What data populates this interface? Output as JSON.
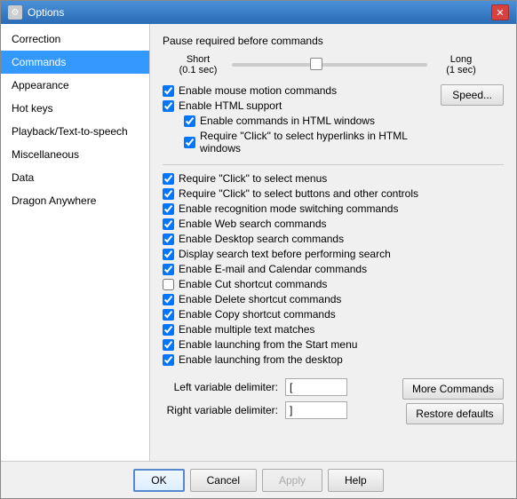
{
  "window": {
    "title": "Options",
    "close_label": "✕"
  },
  "sidebar": {
    "items": [
      {
        "id": "correction",
        "label": "Correction",
        "active": false
      },
      {
        "id": "commands",
        "label": "Commands",
        "active": true
      },
      {
        "id": "appearance",
        "label": "Appearance",
        "active": false
      },
      {
        "id": "hotkeys",
        "label": "Hot keys",
        "active": false
      },
      {
        "id": "playback",
        "label": "Playback/Text-to-speech",
        "active": false
      },
      {
        "id": "miscellaneous",
        "label": "Miscellaneous",
        "active": false
      },
      {
        "id": "data",
        "label": "Data",
        "active": false
      },
      {
        "id": "dragon-anywhere",
        "label": "Dragon Anywhere",
        "active": false
      }
    ]
  },
  "main": {
    "pause_label": "Pause required before commands",
    "short_label": "Short",
    "short_value": "(0.1 sec)",
    "long_label": "Long",
    "long_value": "(1 sec)",
    "speed_button": "Speed...",
    "checkboxes": [
      {
        "id": "mouse-motion",
        "label": "Enable mouse motion commands",
        "checked": true,
        "indent": 0
      },
      {
        "id": "html-support",
        "label": "Enable HTML support",
        "checked": true,
        "indent": 0
      },
      {
        "id": "html-commands",
        "label": "Enable commands in HTML windows",
        "checked": true,
        "indent": 1
      },
      {
        "id": "html-hyperlinks",
        "label": "Require \"Click\" to select hyperlinks in HTML windows",
        "checked": true,
        "indent": 1
      }
    ],
    "checkboxes2": [
      {
        "id": "click-menus",
        "label": "Require \"Click\" to select menus",
        "checked": true
      },
      {
        "id": "click-buttons",
        "label": "Require \"Click\" to select buttons and other controls",
        "checked": true
      },
      {
        "id": "recognition-mode",
        "label": "Enable recognition mode switching commands",
        "checked": true
      },
      {
        "id": "web-search",
        "label": "Enable Web search commands",
        "checked": true
      },
      {
        "id": "desktop-search",
        "label": "Enable Desktop search commands",
        "checked": true
      },
      {
        "id": "display-search",
        "label": "Display search text before performing search",
        "checked": true
      },
      {
        "id": "email-calendar",
        "label": "Enable E-mail and Calendar commands",
        "checked": true
      },
      {
        "id": "cut-shortcut",
        "label": "Enable Cut shortcut commands",
        "checked": false
      },
      {
        "id": "delete-shortcut",
        "label": "Enable Delete shortcut commands",
        "checked": true
      },
      {
        "id": "copy-shortcut",
        "label": "Enable Copy shortcut commands",
        "checked": true
      },
      {
        "id": "multiple-text",
        "label": "Enable multiple text matches",
        "checked": true
      },
      {
        "id": "start-menu",
        "label": "Enable launching from the Start menu",
        "checked": true
      },
      {
        "id": "desktop",
        "label": "Enable launching from the desktop",
        "checked": true
      }
    ],
    "left_delimiter_label": "Left variable delimiter:",
    "left_delimiter_value": "[",
    "right_delimiter_label": "Right variable delimiter:",
    "right_delimiter_value": "]",
    "more_commands_button": "More Commands",
    "restore_defaults_button": "Restore defaults"
  },
  "footer": {
    "ok_label": "OK",
    "cancel_label": "Cancel",
    "apply_label": "Apply",
    "help_label": "Help"
  }
}
